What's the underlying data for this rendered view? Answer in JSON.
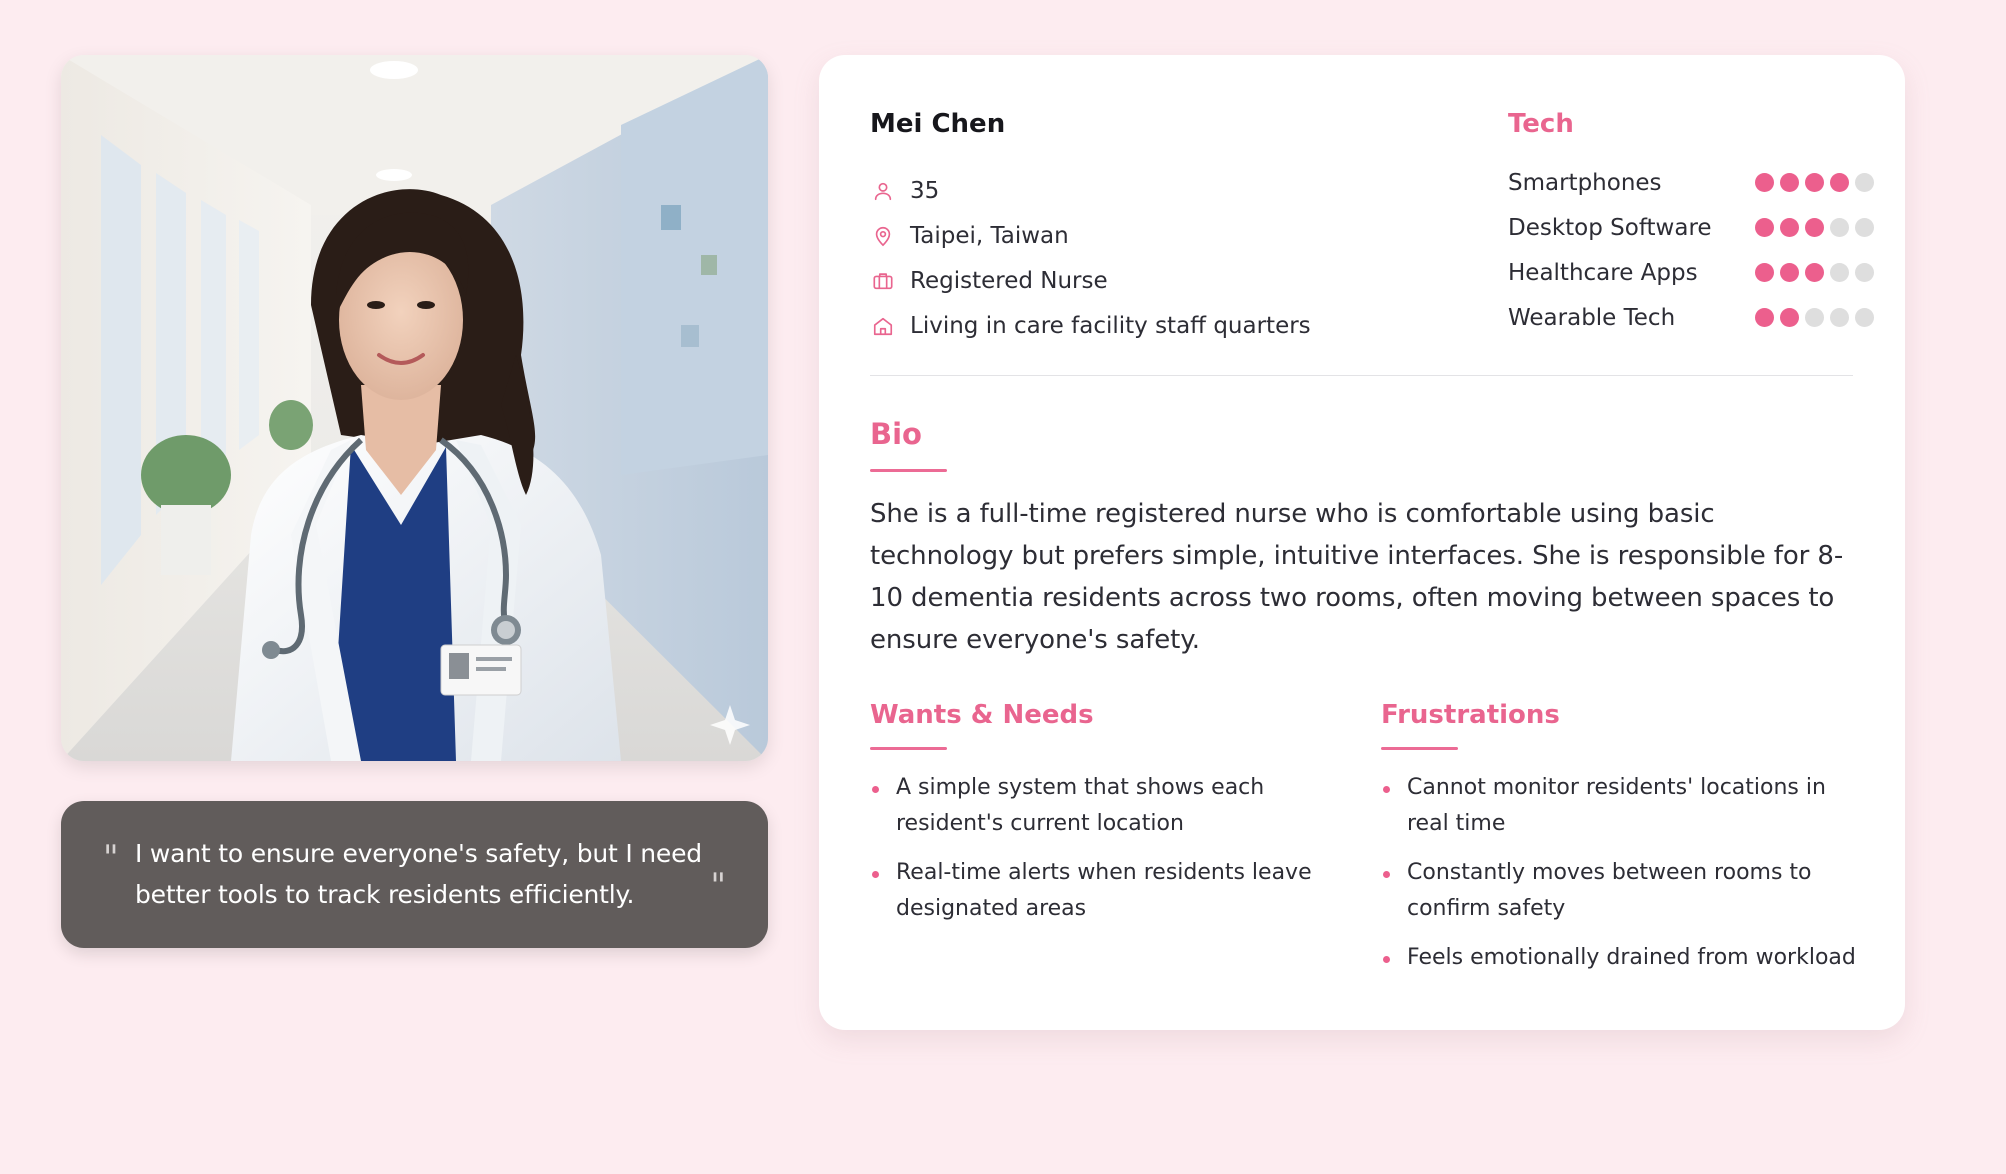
{
  "persona": {
    "name": "Mei Chen",
    "facts": [
      {
        "icon": "person-icon",
        "text": "35"
      },
      {
        "icon": "location-pin-icon",
        "text": "Taipei, Taiwan"
      },
      {
        "icon": "briefcase-icon",
        "text": "Registered Nurse"
      },
      {
        "icon": "home-icon",
        "text": "Living in care facility staff quarters"
      }
    ]
  },
  "photo": {
    "description_icon": "nurse-portrait-photo"
  },
  "quote": {
    "text": "I want to ensure everyone's safety, but I need better tools to track residents efficiently.",
    "open_mark": "\"",
    "close_mark": "\""
  },
  "tech": {
    "title": "Tech",
    "max_level": 5,
    "items": [
      {
        "label": "Smartphones",
        "level": 4
      },
      {
        "label": "Desktop Software",
        "level": 3
      },
      {
        "label": "Healthcare Apps",
        "level": 3
      },
      {
        "label": "Wearable Tech",
        "level": 2
      }
    ]
  },
  "bio": {
    "title": "Bio",
    "text": "She is a full-time registered nurse who is comfortable using basic technology but prefers simple, intuitive interfaces. She is responsible for 8-10 dementia residents across two rooms, often moving between spaces to ensure everyone's safety."
  },
  "wants": {
    "title": "Wants & Needs",
    "items": [
      "A simple system that shows each resident's current location",
      "Real-time alerts when residents leave designated areas"
    ]
  },
  "frustrations": {
    "title": "Frustrations",
    "items": [
      "Cannot monitor residents' locations in real time",
      "Constantly moves between rooms to confirm safety",
      "Feels emotionally drained from workload"
    ]
  },
  "colors": {
    "background": "#fdecf0",
    "accent": "#ec5f8d",
    "quote_bg": "#615c5b",
    "dot_off": "#dedede"
  }
}
